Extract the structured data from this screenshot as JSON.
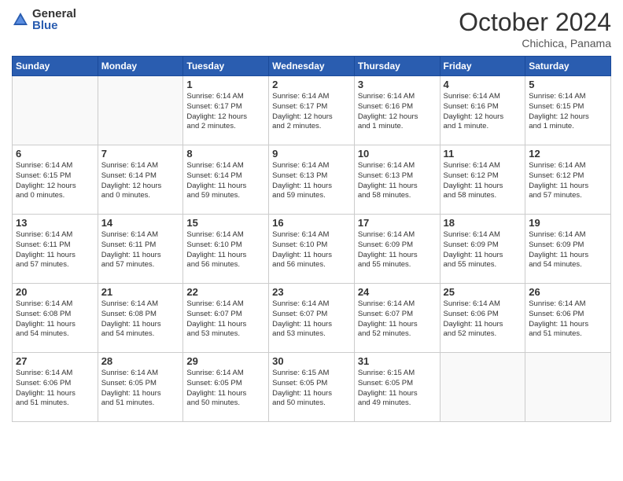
{
  "logo": {
    "general": "General",
    "blue": "Blue"
  },
  "header": {
    "month": "October 2024",
    "location": "Chichica, Panama"
  },
  "weekdays": [
    "Sunday",
    "Monday",
    "Tuesday",
    "Wednesday",
    "Thursday",
    "Friday",
    "Saturday"
  ],
  "weeks": [
    [
      {
        "day": "",
        "info": ""
      },
      {
        "day": "",
        "info": ""
      },
      {
        "day": "1",
        "info": "Sunrise: 6:14 AM\nSunset: 6:17 PM\nDaylight: 12 hours\nand 2 minutes."
      },
      {
        "day": "2",
        "info": "Sunrise: 6:14 AM\nSunset: 6:17 PM\nDaylight: 12 hours\nand 2 minutes."
      },
      {
        "day": "3",
        "info": "Sunrise: 6:14 AM\nSunset: 6:16 PM\nDaylight: 12 hours\nand 1 minute."
      },
      {
        "day": "4",
        "info": "Sunrise: 6:14 AM\nSunset: 6:16 PM\nDaylight: 12 hours\nand 1 minute."
      },
      {
        "day": "5",
        "info": "Sunrise: 6:14 AM\nSunset: 6:15 PM\nDaylight: 12 hours\nand 1 minute."
      }
    ],
    [
      {
        "day": "6",
        "info": "Sunrise: 6:14 AM\nSunset: 6:15 PM\nDaylight: 12 hours\nand 0 minutes."
      },
      {
        "day": "7",
        "info": "Sunrise: 6:14 AM\nSunset: 6:14 PM\nDaylight: 12 hours\nand 0 minutes."
      },
      {
        "day": "8",
        "info": "Sunrise: 6:14 AM\nSunset: 6:14 PM\nDaylight: 11 hours\nand 59 minutes."
      },
      {
        "day": "9",
        "info": "Sunrise: 6:14 AM\nSunset: 6:13 PM\nDaylight: 11 hours\nand 59 minutes."
      },
      {
        "day": "10",
        "info": "Sunrise: 6:14 AM\nSunset: 6:13 PM\nDaylight: 11 hours\nand 58 minutes."
      },
      {
        "day": "11",
        "info": "Sunrise: 6:14 AM\nSunset: 6:12 PM\nDaylight: 11 hours\nand 58 minutes."
      },
      {
        "day": "12",
        "info": "Sunrise: 6:14 AM\nSunset: 6:12 PM\nDaylight: 11 hours\nand 57 minutes."
      }
    ],
    [
      {
        "day": "13",
        "info": "Sunrise: 6:14 AM\nSunset: 6:11 PM\nDaylight: 11 hours\nand 57 minutes."
      },
      {
        "day": "14",
        "info": "Sunrise: 6:14 AM\nSunset: 6:11 PM\nDaylight: 11 hours\nand 57 minutes."
      },
      {
        "day": "15",
        "info": "Sunrise: 6:14 AM\nSunset: 6:10 PM\nDaylight: 11 hours\nand 56 minutes."
      },
      {
        "day": "16",
        "info": "Sunrise: 6:14 AM\nSunset: 6:10 PM\nDaylight: 11 hours\nand 56 minutes."
      },
      {
        "day": "17",
        "info": "Sunrise: 6:14 AM\nSunset: 6:09 PM\nDaylight: 11 hours\nand 55 minutes."
      },
      {
        "day": "18",
        "info": "Sunrise: 6:14 AM\nSunset: 6:09 PM\nDaylight: 11 hours\nand 55 minutes."
      },
      {
        "day": "19",
        "info": "Sunrise: 6:14 AM\nSunset: 6:09 PM\nDaylight: 11 hours\nand 54 minutes."
      }
    ],
    [
      {
        "day": "20",
        "info": "Sunrise: 6:14 AM\nSunset: 6:08 PM\nDaylight: 11 hours\nand 54 minutes."
      },
      {
        "day": "21",
        "info": "Sunrise: 6:14 AM\nSunset: 6:08 PM\nDaylight: 11 hours\nand 54 minutes."
      },
      {
        "day": "22",
        "info": "Sunrise: 6:14 AM\nSunset: 6:07 PM\nDaylight: 11 hours\nand 53 minutes."
      },
      {
        "day": "23",
        "info": "Sunrise: 6:14 AM\nSunset: 6:07 PM\nDaylight: 11 hours\nand 53 minutes."
      },
      {
        "day": "24",
        "info": "Sunrise: 6:14 AM\nSunset: 6:07 PM\nDaylight: 11 hours\nand 52 minutes."
      },
      {
        "day": "25",
        "info": "Sunrise: 6:14 AM\nSunset: 6:06 PM\nDaylight: 11 hours\nand 52 minutes."
      },
      {
        "day": "26",
        "info": "Sunrise: 6:14 AM\nSunset: 6:06 PM\nDaylight: 11 hours\nand 51 minutes."
      }
    ],
    [
      {
        "day": "27",
        "info": "Sunrise: 6:14 AM\nSunset: 6:06 PM\nDaylight: 11 hours\nand 51 minutes."
      },
      {
        "day": "28",
        "info": "Sunrise: 6:14 AM\nSunset: 6:05 PM\nDaylight: 11 hours\nand 51 minutes."
      },
      {
        "day": "29",
        "info": "Sunrise: 6:14 AM\nSunset: 6:05 PM\nDaylight: 11 hours\nand 50 minutes."
      },
      {
        "day": "30",
        "info": "Sunrise: 6:15 AM\nSunset: 6:05 PM\nDaylight: 11 hours\nand 50 minutes."
      },
      {
        "day": "31",
        "info": "Sunrise: 6:15 AM\nSunset: 6:05 PM\nDaylight: 11 hours\nand 49 minutes."
      },
      {
        "day": "",
        "info": ""
      },
      {
        "day": "",
        "info": ""
      }
    ]
  ]
}
